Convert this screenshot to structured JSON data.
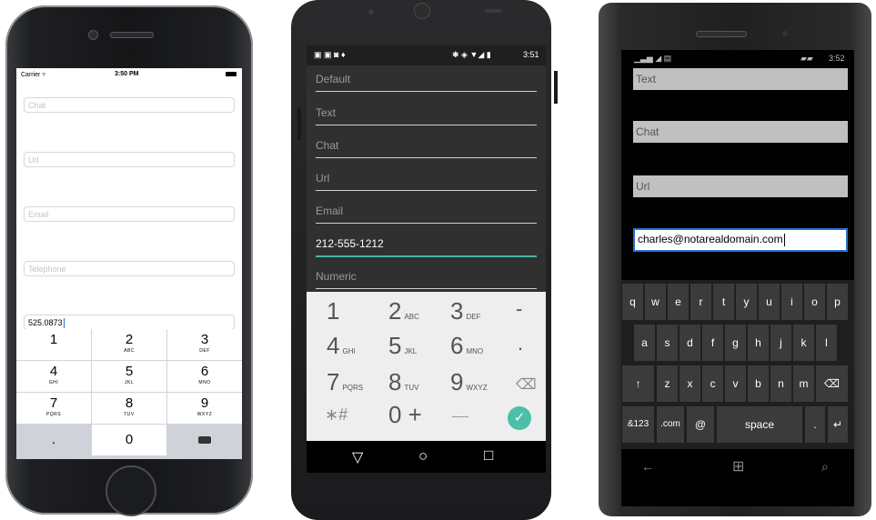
{
  "ios": {
    "status": {
      "carrier": "Carrier ▿",
      "time": "3:50 PM"
    },
    "fields": [
      {
        "placeholder": "Chat",
        "value": ""
      },
      {
        "placeholder": "Url",
        "value": ""
      },
      {
        "placeholder": "Email",
        "value": ""
      },
      {
        "placeholder": "Telephone",
        "value": ""
      },
      {
        "placeholder": "",
        "value": "525.0873"
      }
    ],
    "keypad": [
      {
        "num": "1",
        "letters": ""
      },
      {
        "num": "2",
        "letters": "ABC"
      },
      {
        "num": "3",
        "letters": "DEF"
      },
      {
        "num": "4",
        "letters": "GHI"
      },
      {
        "num": "5",
        "letters": "JKL"
      },
      {
        "num": "6",
        "letters": "MNO"
      },
      {
        "num": "7",
        "letters": "PQRS"
      },
      {
        "num": "8",
        "letters": "TUV"
      },
      {
        "num": "9",
        "letters": "WXYZ"
      },
      {
        "num": ".",
        "letters": ""
      },
      {
        "num": "0",
        "letters": ""
      }
    ]
  },
  "android": {
    "status": {
      "time": "3:51"
    },
    "fields": [
      {
        "label": "Default"
      },
      {
        "label": "Text"
      },
      {
        "label": "Chat"
      },
      {
        "label": "Url"
      },
      {
        "label": "Email"
      },
      {
        "label": "212-555-1212"
      },
      {
        "label": "Numeric"
      }
    ],
    "keypad": [
      {
        "num": "1",
        "letters": ""
      },
      {
        "num": "2",
        "letters": "ABC"
      },
      {
        "num": "3",
        "letters": "DEF"
      },
      {
        "num": "-",
        "letters": ""
      },
      {
        "num": "4",
        "letters": "GHI"
      },
      {
        "num": "5",
        "letters": "JKL"
      },
      {
        "num": "6",
        "letters": "MNO"
      },
      {
        "num": ".",
        "letters": ""
      },
      {
        "num": "7",
        "letters": "PQRS"
      },
      {
        "num": "8",
        "letters": "TUV"
      },
      {
        "num": "9",
        "letters": "WXYZ"
      },
      {
        "num": "⌫",
        "letters": ""
      },
      {
        "num": "∗#",
        "letters": ""
      },
      {
        "num": "0 +",
        "letters": ""
      },
      {
        "num": "__",
        "letters": ""
      },
      {
        "num": "✓",
        "letters": ""
      }
    ],
    "nav": {
      "back": "▽",
      "home": "○",
      "recent": "□"
    }
  },
  "winphone": {
    "status": {
      "time": "3:52"
    },
    "fields": [
      {
        "label": "Text"
      },
      {
        "label": "Chat"
      },
      {
        "label": "Url"
      },
      {
        "label": "charles@notarealdomain.com"
      }
    ],
    "keyboard": {
      "row1": [
        "q",
        "w",
        "e",
        "r",
        "t",
        "y",
        "u",
        "i",
        "o",
        "p"
      ],
      "row2": [
        "a",
        "s",
        "d",
        "f",
        "g",
        "h",
        "j",
        "k",
        "l"
      ],
      "row3": [
        "↑",
        "z",
        "x",
        "c",
        "v",
        "b",
        "n",
        "m",
        "⌫"
      ],
      "row4": [
        "&123",
        ".com",
        "@",
        "space",
        ".",
        "↵"
      ]
    },
    "nav": {
      "back": "←",
      "start": "⊞",
      "search": "⌕"
    }
  }
}
